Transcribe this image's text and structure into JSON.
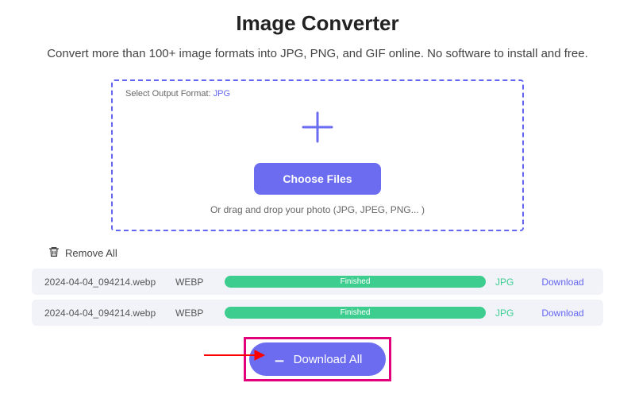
{
  "header": {
    "title": "Image Converter",
    "subtitle": "Convert more than 100+ image formats into JPG, PNG, and GIF online. No software to install and free."
  },
  "dropzone": {
    "format_label": "Select Output Format: ",
    "format_value": "JPG",
    "choose_button": "Choose Files",
    "hint": "Or drag and drop your photo (JPG, JPEG, PNG... )"
  },
  "actions": {
    "remove_all": "Remove All",
    "download_all": "Download All"
  },
  "files": [
    {
      "name": "2024-04-04_094214.webp",
      "source_format": "WEBP",
      "status": "Finished",
      "target_format": "JPG",
      "download_label": "Download"
    },
    {
      "name": "2024-04-04_094214.webp",
      "source_format": "WEBP",
      "status": "Finished",
      "target_format": "JPG",
      "download_label": "Download"
    }
  ]
}
